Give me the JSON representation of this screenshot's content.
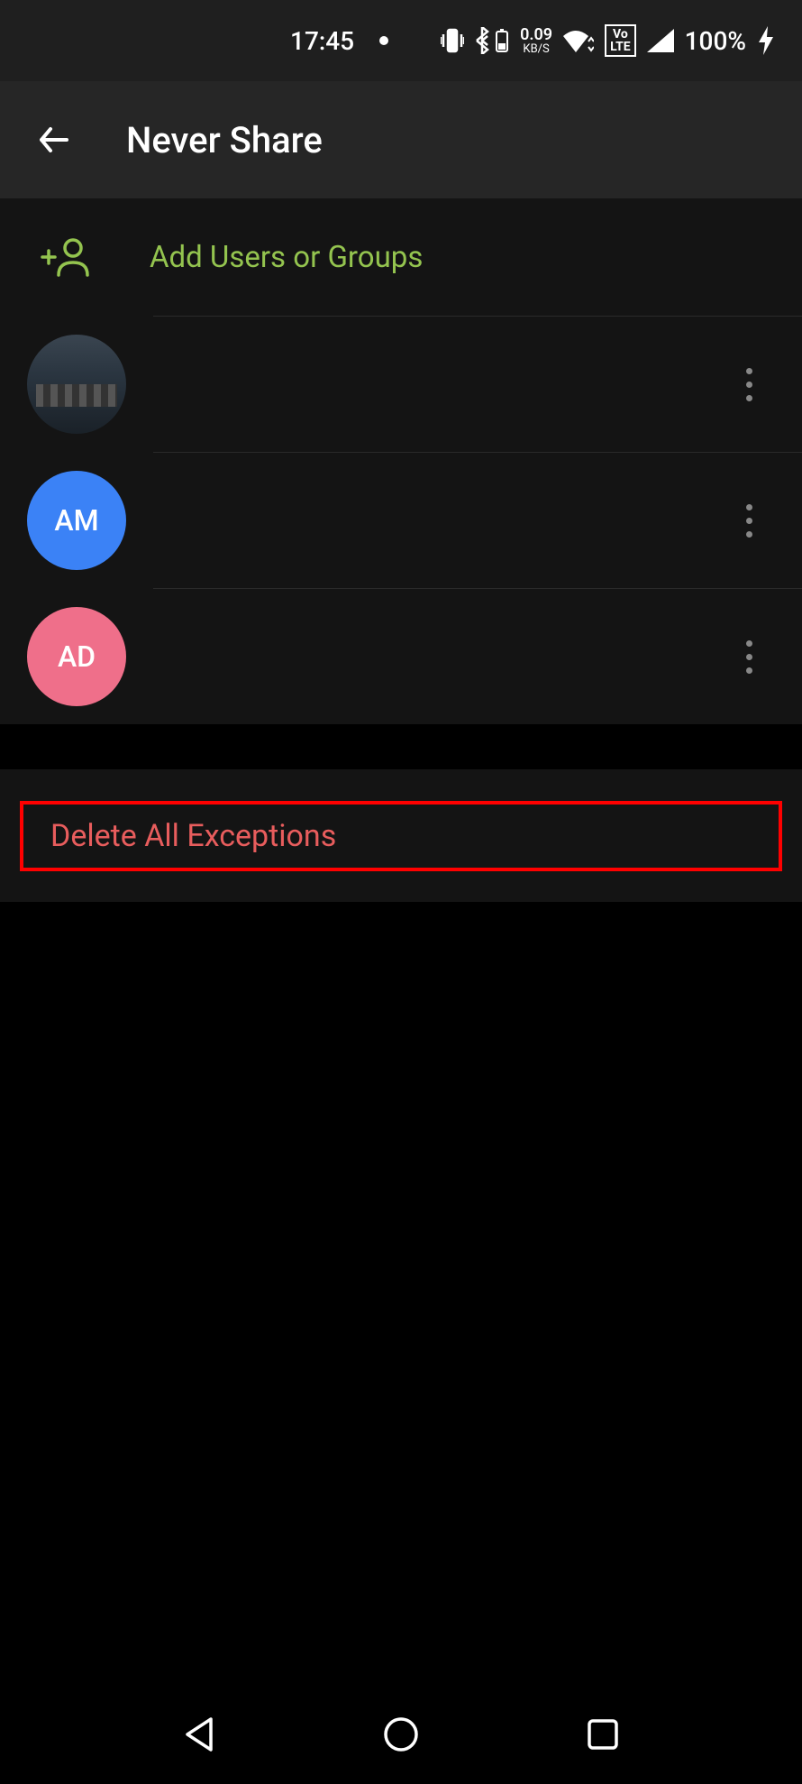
{
  "status": {
    "time": "17:45",
    "speed_value": "0.09",
    "speed_unit": "KB/S",
    "volte": "Vo\nLTE",
    "battery": "100%"
  },
  "header": {
    "title": "Never Share"
  },
  "addUsers": {
    "label": "Add Users or Groups"
  },
  "users": [
    {
      "initials": "",
      "color": "photo"
    },
    {
      "initials": "AM",
      "color": "blue"
    },
    {
      "initials": "AD",
      "color": "pink"
    }
  ],
  "delete": {
    "label": "Delete All Exceptions"
  }
}
